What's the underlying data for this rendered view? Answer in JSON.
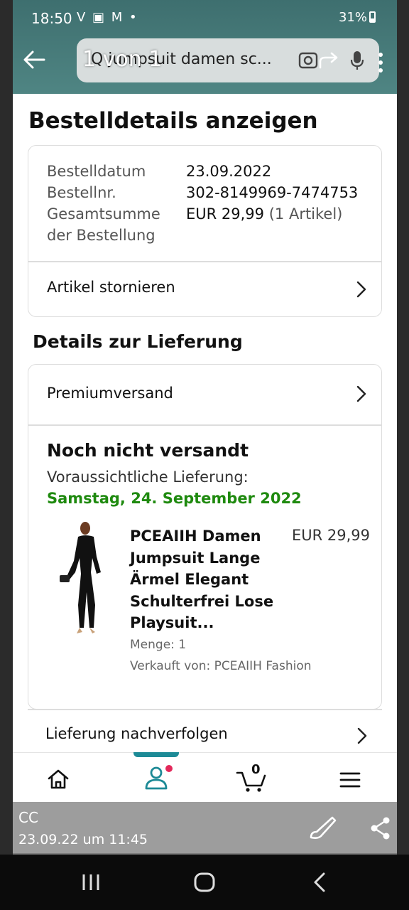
{
  "status_bar": {
    "time": "18:50",
    "left_icons": "V ▣ M •",
    "right_text": "31%"
  },
  "browser": {
    "url_text": "Q jumpsuit damen sc...",
    "page_counter": "1 von 1"
  },
  "page": {
    "title": "Bestelldetails anzeigen",
    "order": {
      "date_label": "Bestelldatum",
      "date_value": "23.09.2022",
      "number_label": "Bestellnr.",
      "number_value": "302-8149969-7474753",
      "total_label_line1": "Gesamtsumme",
      "total_label_line2": "der Bestellung",
      "total_value": "EUR 29,99",
      "total_items": "(1 Artikel)",
      "cancel_label": "Artikel stornieren"
    },
    "delivery": {
      "heading": "Details zur Lieferung",
      "shipping_method": "Premiumversand",
      "status": "Noch nicht versandt",
      "expected_label": "Voraussichtliche Lieferung:",
      "expected_date": "Samstag, 24. September 2022",
      "product": {
        "name": "PCEAIIH Damen Jumpsuit Lange Ärmel Elegant Schulterfrei Lose Playsuit...",
        "price": "EUR 29,99",
        "quantity": "Menge: 1",
        "seller": "Verkauft von: PCEAIIH Fashion"
      },
      "track_label": "Lieferung nachverfolgen"
    }
  },
  "bottom_nav": {
    "cart_count": "0",
    "active_tab": "account",
    "accent": "#1d8a96",
    "badge_color": "#e3285a"
  },
  "overlay": {
    "user": "CC",
    "timestamp": "23.09.22 um 11:45"
  },
  "colors": {
    "delivery_date": "#1f8a0f",
    "header_teal": "#3e6f6f"
  }
}
